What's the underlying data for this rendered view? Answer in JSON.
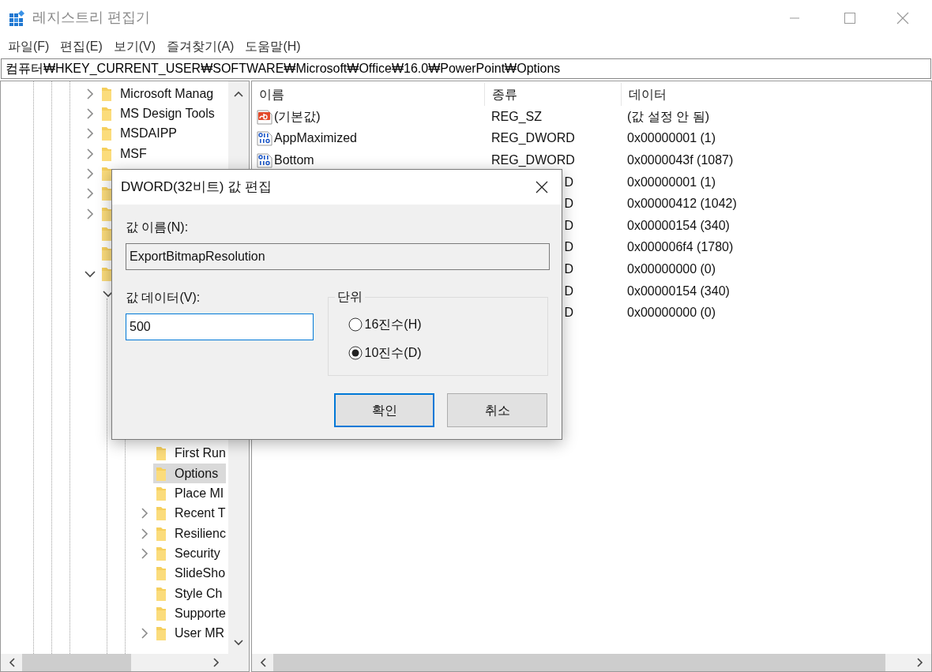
{
  "window": {
    "title": "레지스트리 편집기"
  },
  "menu": [
    {
      "label": "파일(F)"
    },
    {
      "label": "편집(E)"
    },
    {
      "label": "보기(V)"
    },
    {
      "label": "즐겨찾기(A)"
    },
    {
      "label": "도움말(H)"
    }
  ],
  "address": "컴퓨터₩HKEY_CURRENT_USER₩SOFTWARE₩Microsoft₩Office₩16.0₩PowerPoint₩Options",
  "tree": {
    "items": [
      {
        "label": "Microsoft Manag",
        "has_children": true,
        "expanded": false,
        "selected": false
      },
      {
        "label": "MS Design Tools",
        "has_children": true,
        "expanded": false,
        "selected": false
      },
      {
        "label": "MSDAIPP",
        "has_children": true,
        "expanded": false,
        "selected": false
      },
      {
        "label": "MSF",
        "has_children": true,
        "expanded": false,
        "selected": false
      },
      {
        "has_children": true,
        "expanded": false,
        "selected": false
      },
      {
        "has_children": true,
        "expanded": false,
        "selected": false
      },
      {
        "has_children": true,
        "expanded": false,
        "selected": false
      },
      {
        "has_children": false,
        "selected": false
      },
      {
        "has_children": false,
        "selected": false
      },
      {
        "has_children": true,
        "expanded": true,
        "selected": false,
        "children": [
          {
            "has_children": true,
            "expanded": true,
            "children": [
              {
                "label": "First Run",
                "has_children": false,
                "selected": false
              },
              {
                "label": "Options",
                "has_children": false,
                "selected": true
              },
              {
                "label": "Place MI",
                "has_children": false,
                "selected": false
              },
              {
                "label": "Recent T",
                "has_children": true,
                "expanded": false,
                "selected": false
              },
              {
                "label": "Resilienc",
                "has_children": true,
                "expanded": false,
                "selected": false
              },
              {
                "label": "Security",
                "has_children": true,
                "expanded": false,
                "selected": false
              },
              {
                "label": "SlideSho",
                "has_children": false,
                "selected": false
              },
              {
                "label": "Style Ch",
                "has_children": false,
                "selected": false
              },
              {
                "label": "Supporte",
                "has_children": false,
                "selected": false
              },
              {
                "label": "User MR",
                "has_children": true,
                "expanded": false,
                "selected": false
              }
            ]
          }
        ]
      }
    ]
  },
  "values": {
    "columns": [
      "이름",
      "종류",
      "데이터"
    ],
    "rows": [
      {
        "kind": "string",
        "name": "(기본값)",
        "type": "REG_SZ",
        "data": "(값 설정 안 됨)"
      },
      {
        "kind": "dword",
        "name": "AppMaximized",
        "type": "REG_DWORD",
        "data": "0x00000001 (1)"
      },
      {
        "kind": "dword",
        "name": "Bottom",
        "type": "REG_DWORD",
        "data": "0x0000043f (1087)"
      },
      {
        "kind": "covered",
        "type": "D",
        "data": "0x00000001 (1)"
      },
      {
        "kind": "covered",
        "type": "D",
        "data": "0x00000412 (1042)"
      },
      {
        "kind": "covered",
        "type": "D",
        "data": "0x00000154 (340)"
      },
      {
        "kind": "covered",
        "type": "D",
        "data": "0x000006f4 (1780)"
      },
      {
        "kind": "covered",
        "type": "D",
        "data": "0x00000000 (0)"
      },
      {
        "kind": "covered",
        "type": "D",
        "data": "0x00000154 (340)"
      },
      {
        "kind": "covered",
        "type": "D",
        "data": "0x00000000 (0)"
      }
    ]
  },
  "dialog": {
    "title": "DWORD(32비트) 값 편집",
    "name_label": "값 이름(N):",
    "name_value": "ExportBitmapResolution",
    "data_label": "값 데이터(V):",
    "data_value": "500",
    "base_group": "단위",
    "bases": [
      {
        "label": "16진수(H)",
        "selected": false
      },
      {
        "label": "10진수(D)",
        "selected": true
      }
    ],
    "buttons": [
      {
        "label": "확인",
        "default": true
      },
      {
        "label": "취소",
        "default": false
      }
    ]
  }
}
